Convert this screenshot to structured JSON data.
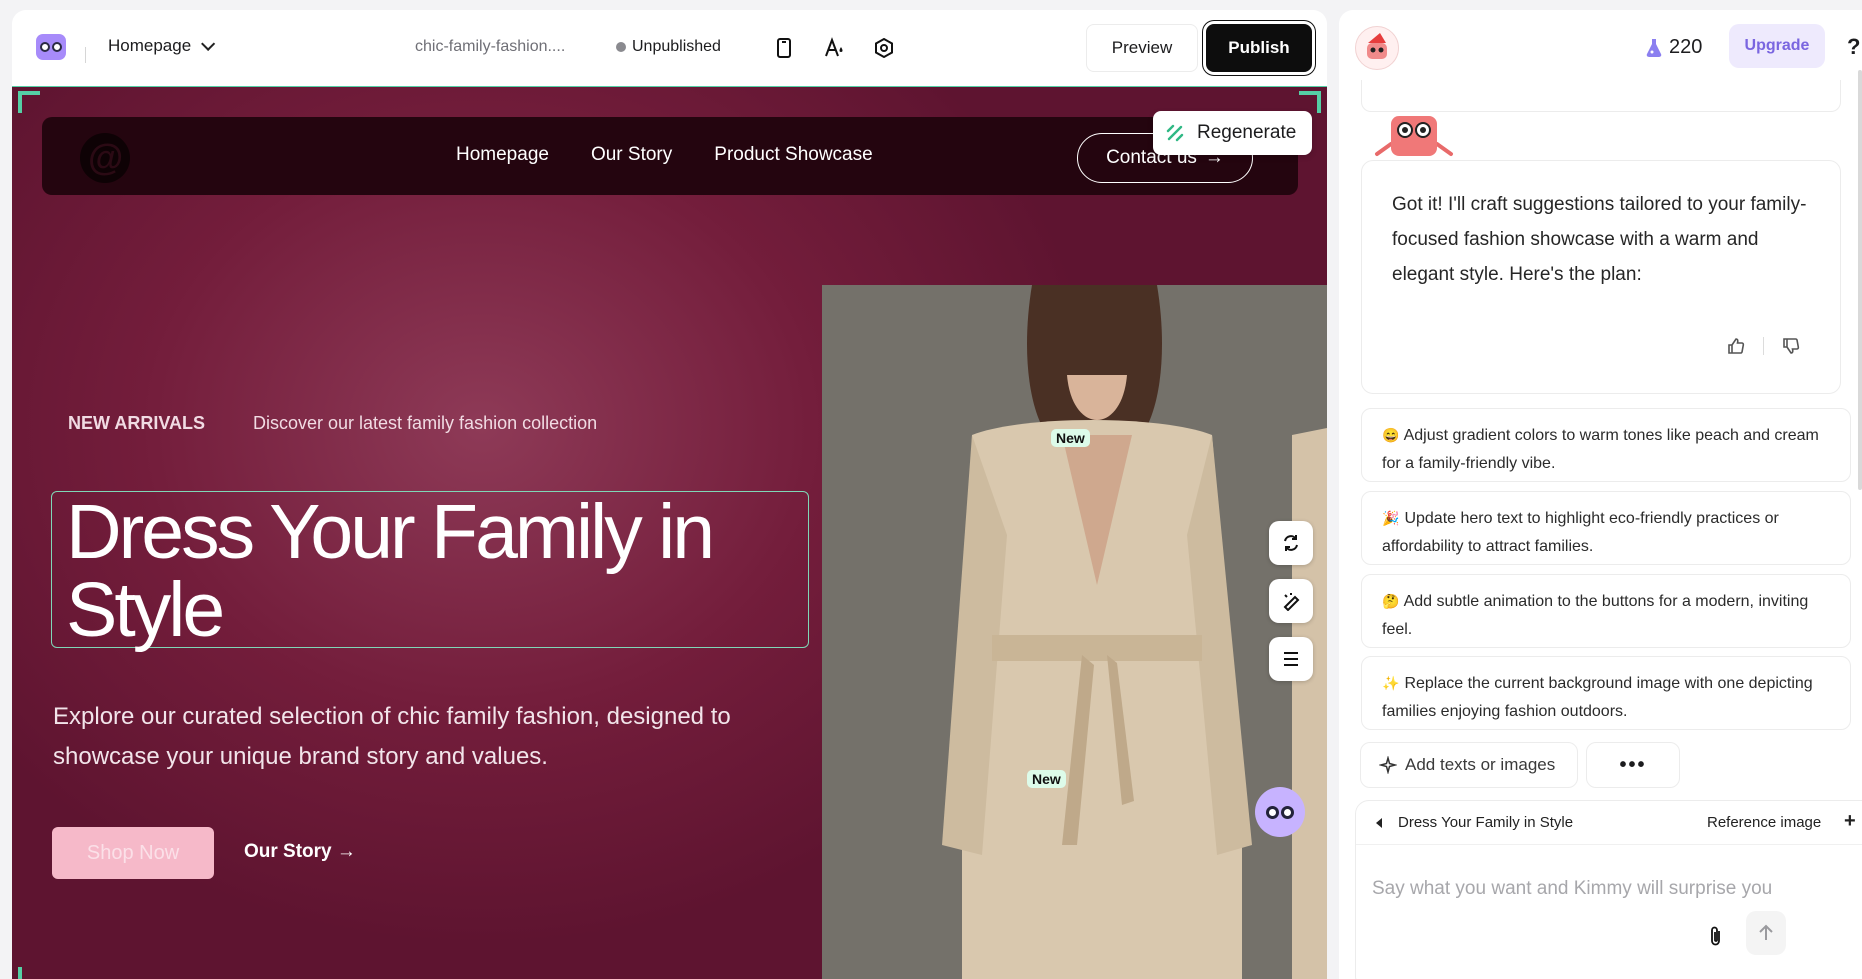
{
  "topbar": {
    "page_selector": "Homepage",
    "project_name": "chic-family-fashion....",
    "status": "Unpublished",
    "preview_label": "Preview",
    "publish_label": "Publish"
  },
  "site": {
    "nav_links": [
      "Homepage",
      "Our Story",
      "Product Showcase"
    ],
    "contact_label": "Contact us",
    "regenerate_label": "Regenerate",
    "eyebrow_label": "NEW ARRIVALS",
    "eyebrow_text": "Discover our latest family fashion collection",
    "hero_title": "Dress Your Family in Style",
    "hero_desc": "Explore our curated selection of chic family fashion, designed to showcase your unique brand story and values.",
    "shop_label": "Shop Now",
    "story_label": "Our Story →",
    "new_badge": "New"
  },
  "panel": {
    "credits": "220",
    "upgrade_label": "Upgrade",
    "help": "?",
    "message": "Got it! I'll craft suggestions tailored to your family-focused fashion showcase with a warm and elegant style. Here's the plan:",
    "suggestions": [
      {
        "emoji": "😄",
        "text": "Adjust gradient colors to warm tones like peach and cream for a family-friendly vibe."
      },
      {
        "emoji": "🎉",
        "text": "Update hero text to highlight eco-friendly practices or affordability to attract families."
      },
      {
        "emoji": "🤔",
        "text": "Add subtle animation to the buttons for a modern, inviting feel."
      },
      {
        "emoji": "✨",
        "text": "Replace the current background image with one depicting families enjoying fashion outdoors."
      }
    ],
    "add_label": "Add texts or images",
    "more_label": "•••",
    "context_title": "Dress Your Family in Style",
    "reference_label": "Reference image",
    "plus": "+",
    "prompt_placeholder": "Say what you want and Kimmy will surprise you"
  },
  "colors": {
    "accent": "#55cfa5",
    "hero_bg": "#731d3b",
    "nav_bg": "#24050f",
    "shop_btn": "#f6b9c9",
    "upgrade_text": "#7a66e0"
  }
}
